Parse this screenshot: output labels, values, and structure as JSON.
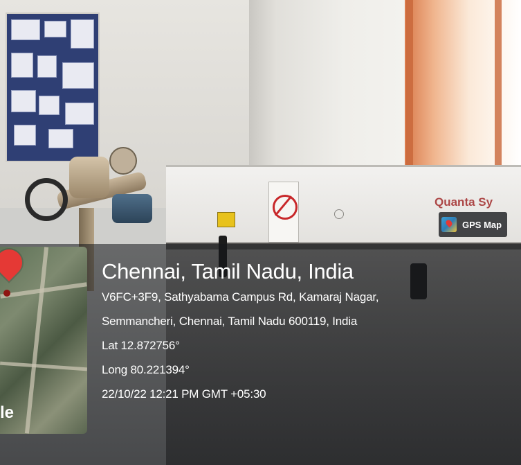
{
  "overlay": {
    "location_title": "Chennai, Tamil Nadu, India",
    "address_line_1": "V6FC+3F9, Sathyabama Campus Rd, Kamaraj Nagar,",
    "address_line_2": "Semmancheri, Chennai, Tamil Nadu 600119, India",
    "latitude": "Lat 12.872756°",
    "longitude": "Long 80.221394°",
    "timestamp": "22/10/22 12:21 PM GMT +05:30",
    "map_logo_fragment": "le",
    "badge_label": "GPS Map",
    "pin_color": "#e53935"
  },
  "scene": {
    "machine_label_fragment": "Quanta Sy",
    "sign_color": "#c8282a",
    "sticker_color": "#e8c21c"
  }
}
